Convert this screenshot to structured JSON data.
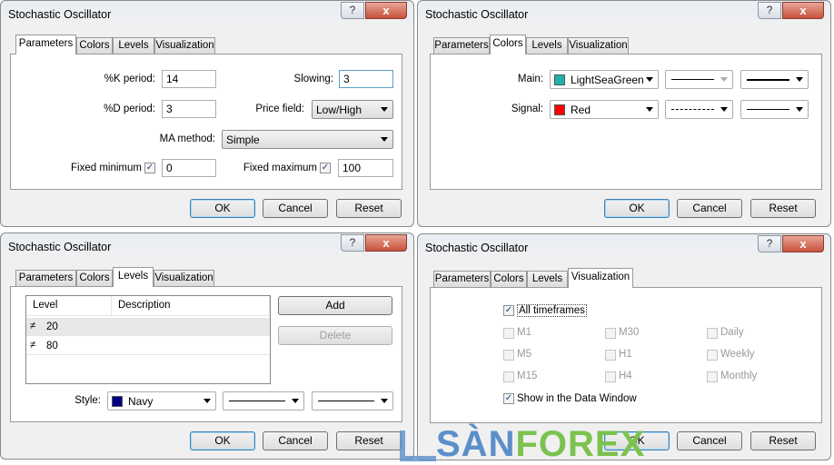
{
  "title": "Stochastic Oscillator",
  "help": "?",
  "close": "x",
  "tabs": [
    "Parameters",
    "Colors",
    "Levels",
    "Visualization"
  ],
  "buttons": {
    "ok": "OK",
    "cancel": "Cancel",
    "reset": "Reset",
    "add": "Add",
    "delete": "Delete"
  },
  "parameters": {
    "k_label": "%K period:",
    "k_value": "14",
    "slowing_label": "Slowing:",
    "slowing_value": "3",
    "d_label": "%D period:",
    "d_value": "3",
    "price_label": "Price field:",
    "price_value": "Low/High",
    "ma_label": "MA method:",
    "ma_value": "Simple",
    "fmin_label": "Fixed minimum",
    "fmin_checked": true,
    "fmin_value": "0",
    "fmax_label": "Fixed maximum",
    "fmax_checked": true,
    "fmax_value": "100"
  },
  "colors": {
    "main_label": "Main:",
    "main_color": "LightSeaGreen",
    "main_hex": "#20b2aa",
    "main_style": "solid",
    "main_width": "thick",
    "signal_label": "Signal:",
    "signal_color": "Red",
    "signal_hex": "#ff0000",
    "signal_style": "dashed",
    "signal_width": "thin"
  },
  "levels": {
    "headers": [
      "Level",
      "Description"
    ],
    "rows": [
      {
        "level": "20",
        "description": ""
      },
      {
        "level": "80",
        "description": ""
      }
    ],
    "style_label": "Style:",
    "style_color": "Navy",
    "style_hex": "#000080"
  },
  "visualization": {
    "all_timeframes": {
      "label": "All timeframes",
      "checked": true
    },
    "timeframes": [
      [
        "M1",
        "M30",
        "Daily"
      ],
      [
        "M5",
        "H1",
        "Weekly"
      ],
      [
        "M15",
        "H4",
        "Monthly"
      ]
    ],
    "data_window": {
      "label": "Show in the Data Window",
      "checked": true
    }
  },
  "watermark": {
    "part1": "SÀN",
    "part2": "FOREX",
    "color1": "#5b8fc9",
    "color2": "#7cc24f"
  }
}
